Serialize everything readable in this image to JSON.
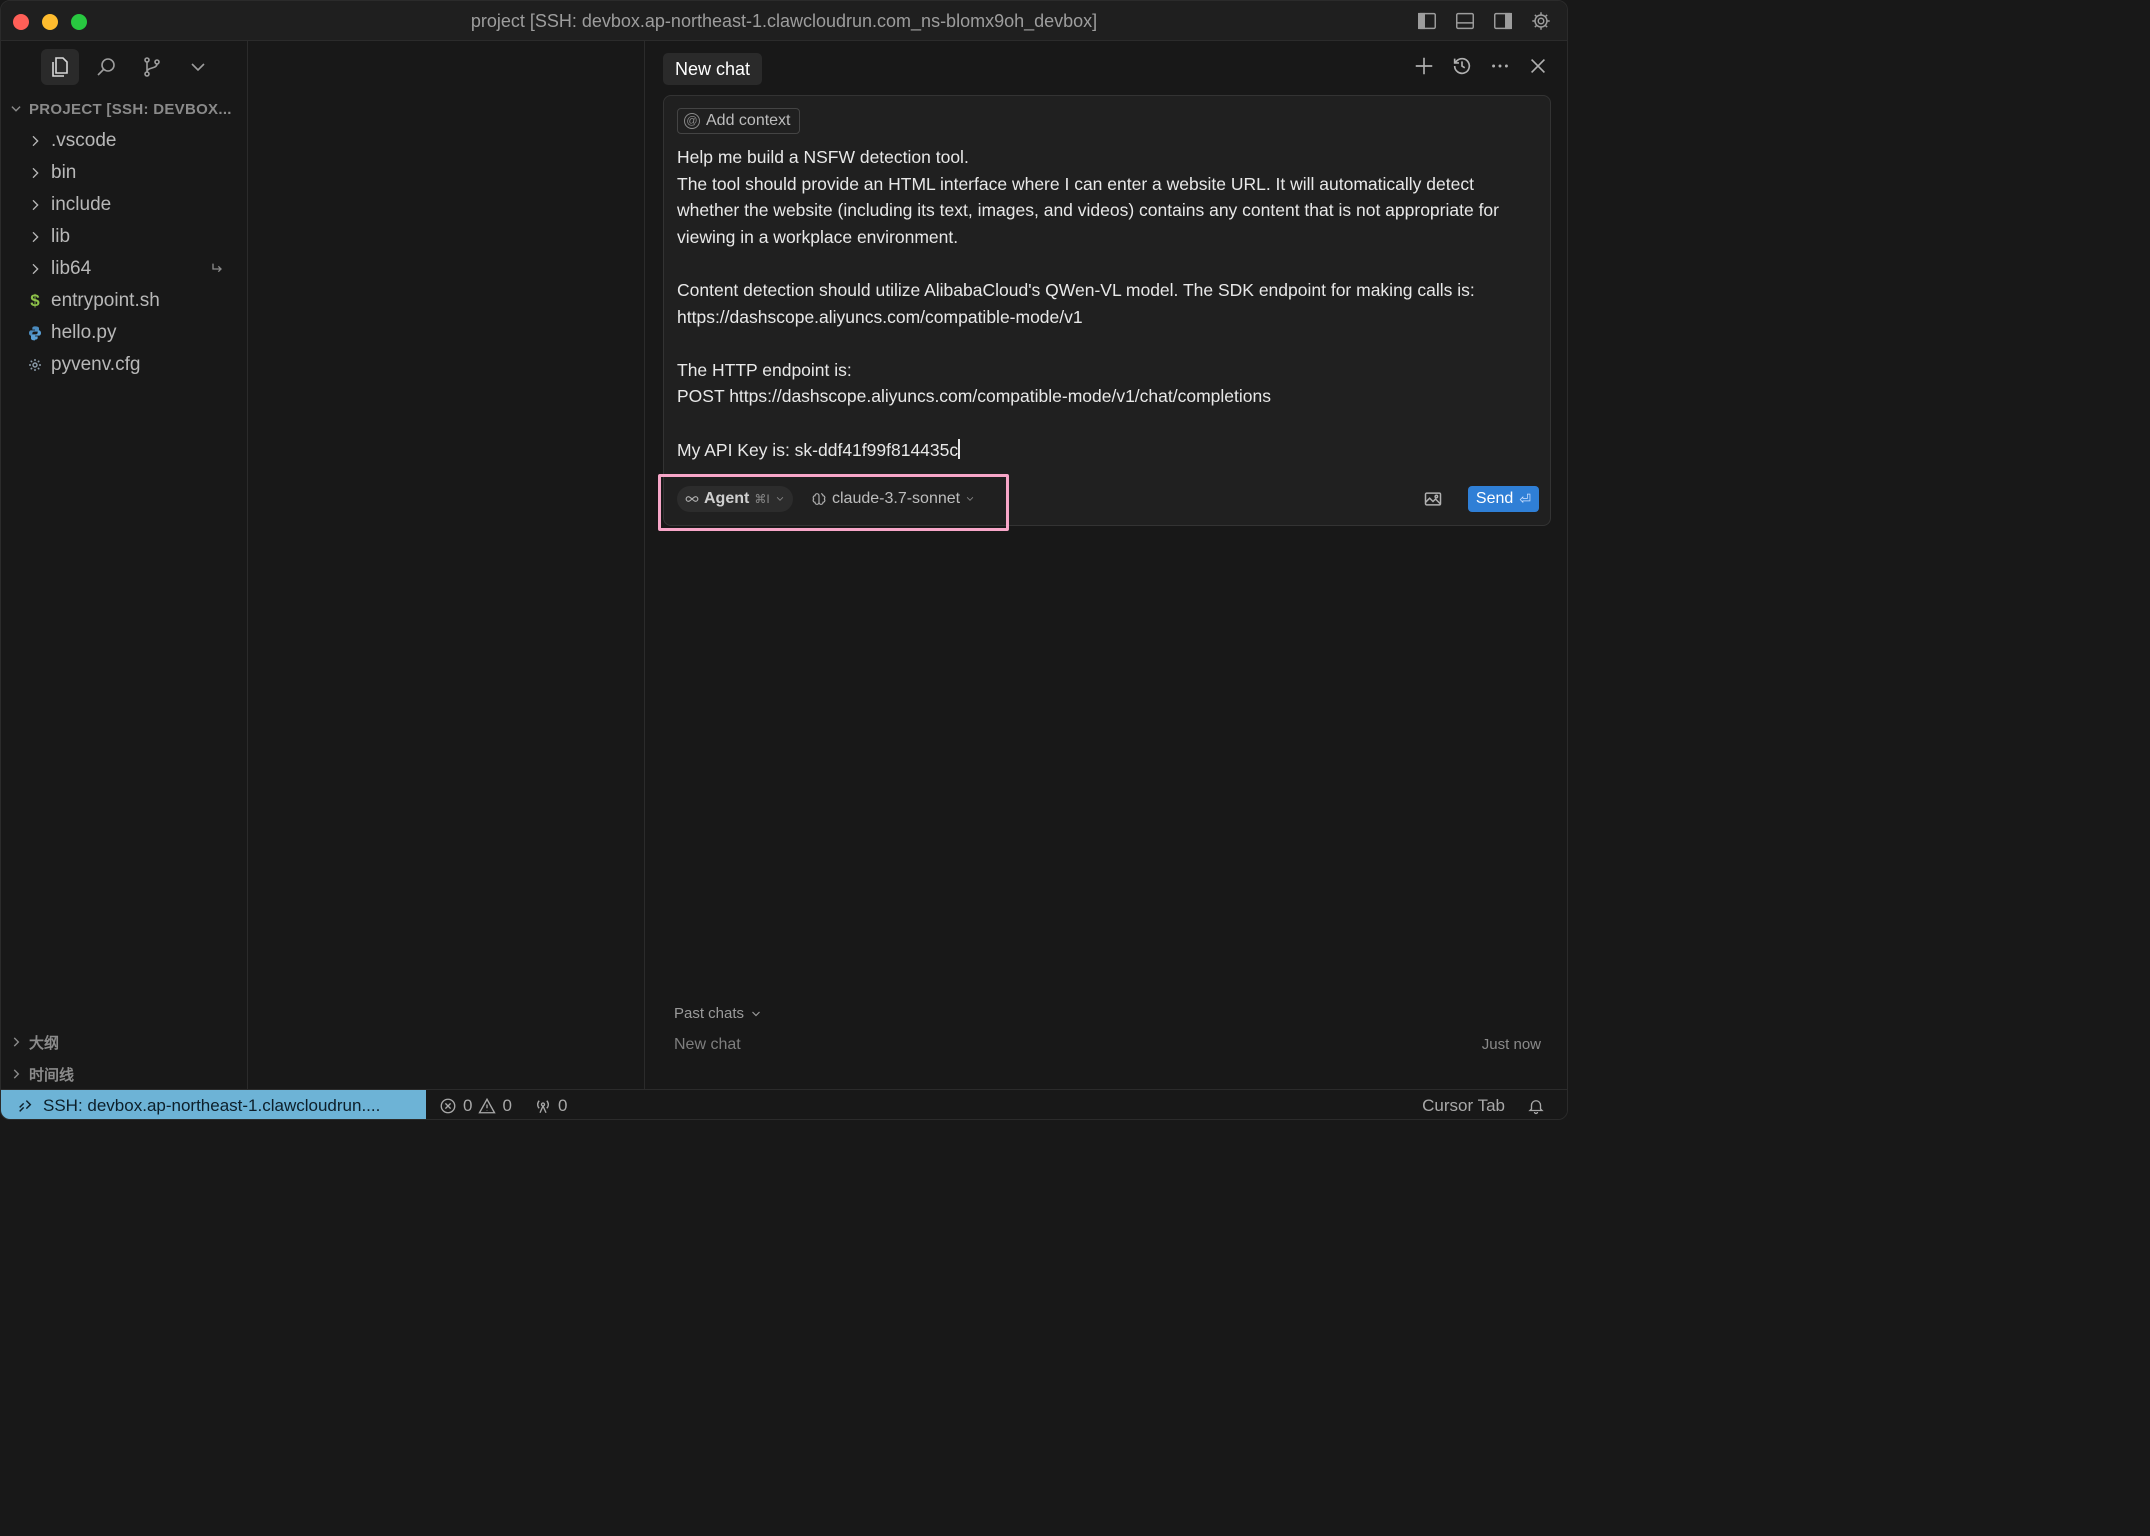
{
  "window": {
    "title": "project [SSH: devbox.ap-northeast-1.clawcloudrun.com_ns-blomx9oh_devbox]"
  },
  "sidebar": {
    "header": "PROJECT [SSH: DEVBOX...",
    "items": [
      {
        "label": ".vscode",
        "type": "folder"
      },
      {
        "label": "bin",
        "type": "folder"
      },
      {
        "label": "include",
        "type": "folder"
      },
      {
        "label": "lib",
        "type": "folder"
      },
      {
        "label": "lib64",
        "type": "folder-symlink"
      },
      {
        "label": "entrypoint.sh",
        "type": "shell-file"
      },
      {
        "label": "hello.py",
        "type": "python-file"
      },
      {
        "label": "pyvenv.cfg",
        "type": "config-file"
      }
    ],
    "sections": {
      "outline": "大纲",
      "timeline": "时间线"
    }
  },
  "chat": {
    "tab_label": "New chat",
    "add_context_label": "Add context",
    "prompt_text": "Help me build a NSFW detection tool.\nThe tool should provide an HTML interface where I can enter a website URL. It will automatically detect whether the website (including its text, images, and videos) contains any content that is not appropriate for viewing in a workplace environment.\n\nContent detection should utilize AlibabaCloud's QWen-VL model. The SDK endpoint for making calls is:\nhttps://dashscope.aliyuncs.com/compatible-mode/v1\n\nThe HTTP endpoint is:\nPOST https://dashscope.aliyuncs.com/compatible-mode/v1/chat/completions\n\nMy API Key is: sk-ddf41f99f814435c",
    "mode_label": "Agent",
    "mode_shortcut": "⌘I",
    "model_label": "claude-3.7-sonnet",
    "send_label": "Send",
    "send_hint": "⏎",
    "past_chats_label": "Past chats",
    "past_chats": [
      {
        "name": "New chat",
        "time": "Just now"
      }
    ]
  },
  "statusbar": {
    "remote_label": "SSH: devbox.ap-northeast-1.clawcloudrun....",
    "errors": "0",
    "warnings": "0",
    "ports": "0",
    "cursor_tab": "Cursor Tab"
  },
  "colors": {
    "accent": "#2f7fd6",
    "remote_bg": "#6db3d6",
    "highlight": "#f7a6c8"
  }
}
